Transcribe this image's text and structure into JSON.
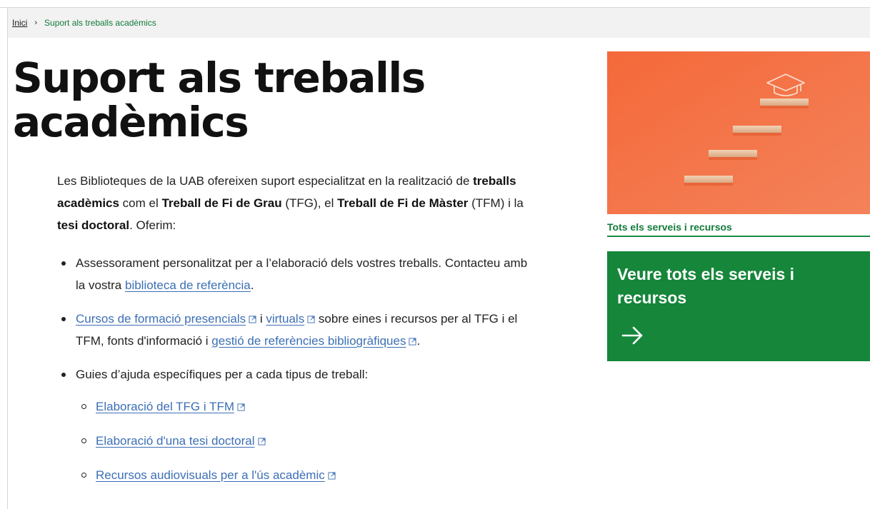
{
  "breadcrumb": {
    "home": "Inici",
    "separator": "›",
    "current": "Suport als treballs acadèmics"
  },
  "page": {
    "title": "Suport als treballs acadèmics"
  },
  "intro": {
    "t1": "Les Biblioteques de la UAB ofereixen suport especialitzat en la realització de ",
    "b1": "treballs acadèmics",
    "t2": " com el ",
    "b2": "Treball de Fi de Grau",
    "t3": " (TFG), el ",
    "b3": "Treball de Fi de Màster",
    "t4": " (TFM) i la ",
    "b4": "tesi doctoral",
    "t5": ". Oferim:"
  },
  "items": {
    "i1": {
      "text": "Assessorament personalitzat per a l’elaboració dels vostres treballs. Contacteu amb la vostra ",
      "link": "biblioteca de referència",
      "end": "."
    },
    "i2": {
      "link1": "Cursos de formació presencials",
      "mid": " i ",
      "link2": "virtuals",
      "text": " sobre eines i recursos per al TFG i el TFM, fonts d'informació i ",
      "link3": "gestió de referències bibliogràfiques",
      "end": "."
    },
    "i3": {
      "text": "Guies d’ajuda específiques per a cada tipus de treball:",
      "sub": [
        "Elaboració del TFG i TFM",
        "Elaboració d'una tesi doctoral",
        "Recursos audiovisuals per a l'ús acadèmic"
      ]
    }
  },
  "sidebar": {
    "label": "Tots els serveis i recursos",
    "cta_title": "Veure tots els serveis i recursos"
  },
  "icons": {
    "external": "external-link-icon",
    "arrow": "arrow-right-icon",
    "cap": "graduation-cap-icon"
  },
  "colors": {
    "accent_green": "#15863a",
    "link_blue": "#3c6fb5",
    "hero_orange": "#f26a3d"
  }
}
